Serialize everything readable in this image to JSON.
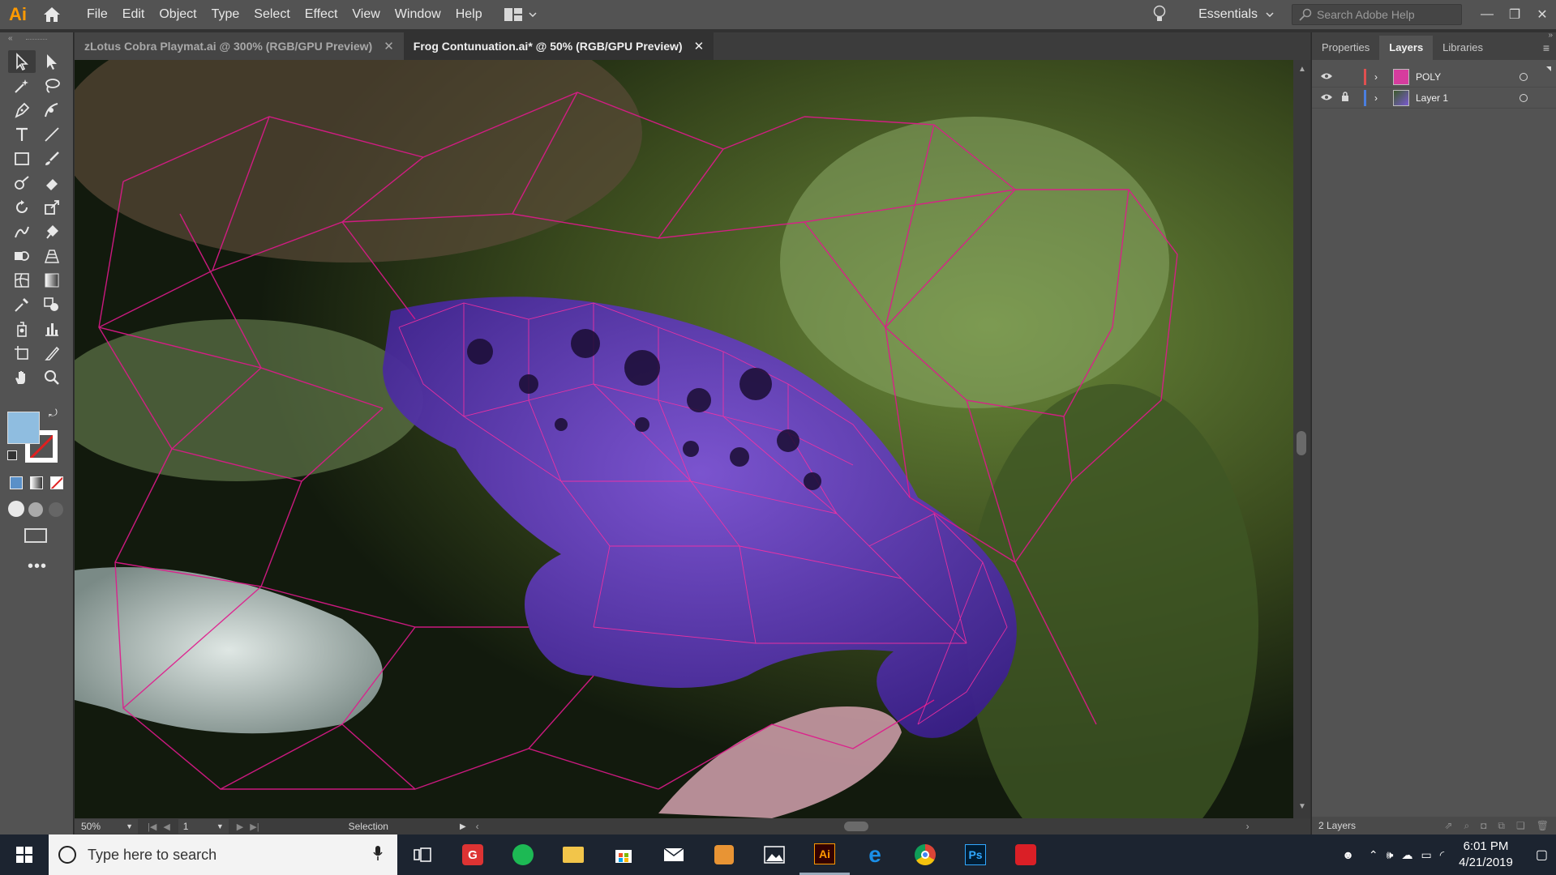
{
  "app": {
    "logo": "Ai",
    "menu": [
      "File",
      "Edit",
      "Object",
      "Type",
      "Select",
      "Effect",
      "View",
      "Window",
      "Help"
    ],
    "workspace": "Essentials",
    "search_placeholder": "Search Adobe Help"
  },
  "tabs": [
    {
      "label": "zLotus Cobra Playmat.ai @ 300% (RGB/GPU Preview)",
      "active": false
    },
    {
      "label": "Frog Contunuation.ai* @ 50% (RGB/GPU Preview)",
      "active": true
    }
  ],
  "panel": {
    "tabs": [
      "Properties",
      "Layers",
      "Libraries"
    ],
    "active_tab": "Layers",
    "layers": [
      {
        "name": "POLY",
        "color": "#e05050",
        "locked": false
      },
      {
        "name": "Layer 1",
        "color": "#4a7fe0",
        "locked": true
      }
    ],
    "footer": "2 Layers"
  },
  "status": {
    "zoom": "50%",
    "artboard": "1",
    "tool": "Selection"
  },
  "colors": {
    "fill": "#8fbde0",
    "stroke": "#ffffff",
    "mesh": "#e0198c"
  },
  "taskbar": {
    "search_placeholder": "Type here to search",
    "apps": [
      "task-view",
      "gmail",
      "spotify",
      "file-explorer",
      "store",
      "mail",
      "instagram",
      "photos",
      "illustrator",
      "edge",
      "chrome",
      "photoshop",
      "creative-cloud"
    ],
    "time": "6:01 PM",
    "date": "4/21/2019"
  }
}
